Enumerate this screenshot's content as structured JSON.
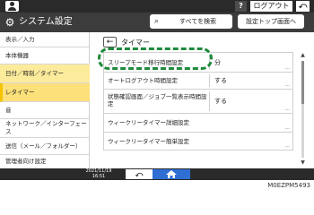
{
  "topbar": {
    "user_icon": "user-icon",
    "help_label": "?",
    "login_label": "ログアウト",
    "back_label": "⤺"
  },
  "titlebar": {
    "title": "システム設定",
    "search_label": "すべてを検索",
    "toppage_label": "設定トップ画面へ"
  },
  "sidebar": {
    "items": [
      {
        "label": "表示／入力"
      },
      {
        "label": "本体機器"
      },
      {
        "label": "日付／時刻／タイマー"
      },
      {
        "label": "レタイマー"
      },
      {
        "label": "音"
      },
      {
        "label": "ネットワーク／インターフェース"
      },
      {
        "label": "送信（メール／フォルダー）"
      },
      {
        "label": "管理者向け設定"
      }
    ]
  },
  "content": {
    "breadcrumb_back": "←",
    "breadcrumb_title": "タイマー",
    "rows": [
      {
        "label": "スリープモード移行時間設定",
        "value": "分"
      },
      {
        "label": "オートログアウト時間設定",
        "value": "する"
      },
      {
        "label": "状態確認画面／ジョブ一覧表示時間設定",
        "value": "する"
      },
      {
        "label": "ウィークリータイマー詳細設定",
        "value": ""
      },
      {
        "label": "ウィークリータイマー簡単設定",
        "value": ""
      }
    ],
    "more_glyph": "..."
  },
  "bottombar": {
    "datetime_line1": "2021/11/19",
    "datetime_line2": "16:51",
    "back_label": "⤺"
  },
  "caption": "M0EZPM5493",
  "colors": {
    "selected_bg": "#fdeb9c",
    "highlight_green": "#1f8a3a",
    "home_blue": "#2f6fd4"
  }
}
